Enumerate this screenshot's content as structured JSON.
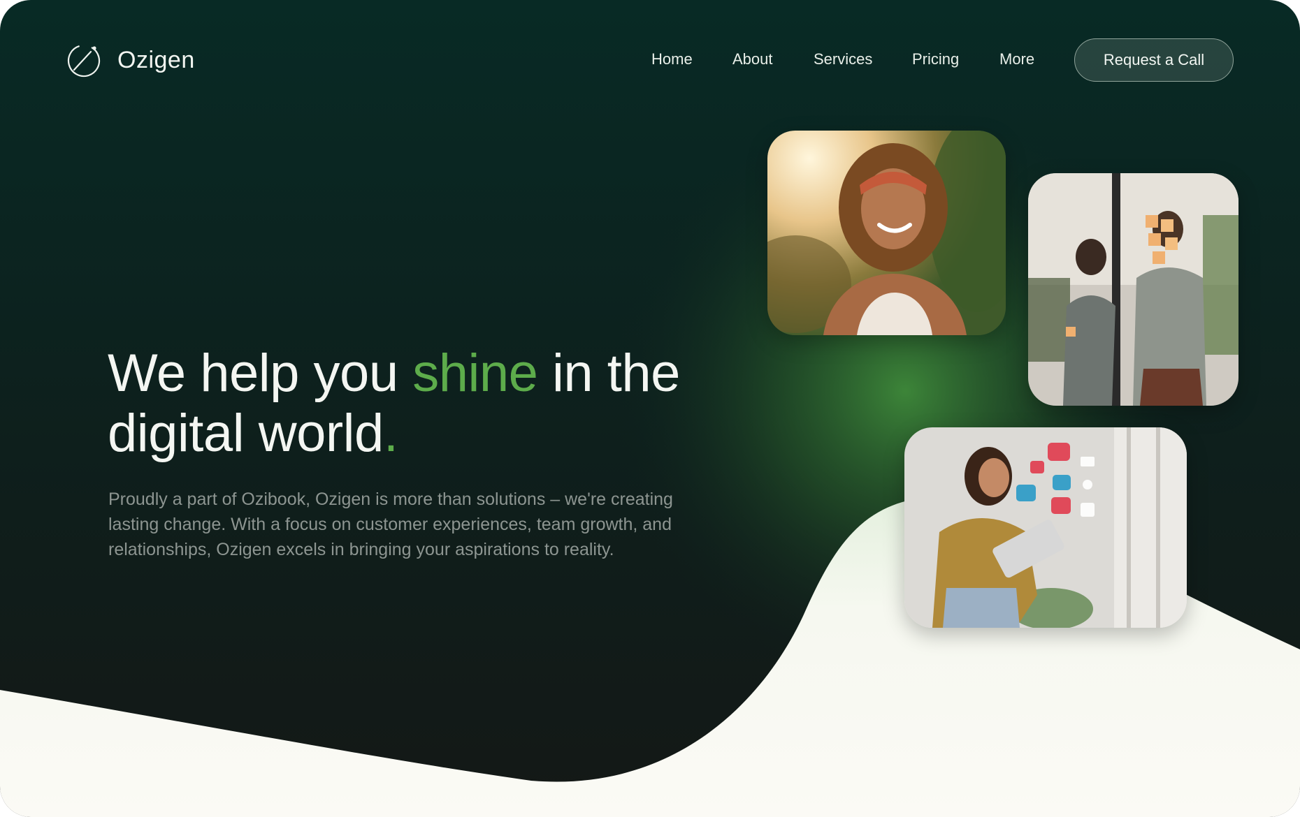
{
  "brand": {
    "name": "Ozigen",
    "logo_icon": "orbit-logo-icon"
  },
  "nav": {
    "items": [
      {
        "label": "Home"
      },
      {
        "label": "About"
      },
      {
        "label": "Services"
      },
      {
        "label": "Pricing"
      },
      {
        "label": "More"
      }
    ],
    "cta_label": "Request a Call"
  },
  "hero": {
    "headline_before": "We help you ",
    "headline_accent": "shine",
    "headline_after": " in the digital world",
    "headline_period": ".",
    "description": "Proudly a part of Ozibook, Ozigen is more than solutions – we're creating lasting change. With a focus on customer experiences, team growth, and relationships, Ozigen excels in bringing your aspirations to reality."
  },
  "photos": [
    {
      "icon": "smiling-woman-photo"
    },
    {
      "icon": "team-sticky-notes-photo"
    },
    {
      "icon": "woman-tablet-social-photo"
    }
  ],
  "colors": {
    "background_dark": "#0a2a24",
    "accent_green": "#5dac4b",
    "cream": "#fbfaf5"
  }
}
